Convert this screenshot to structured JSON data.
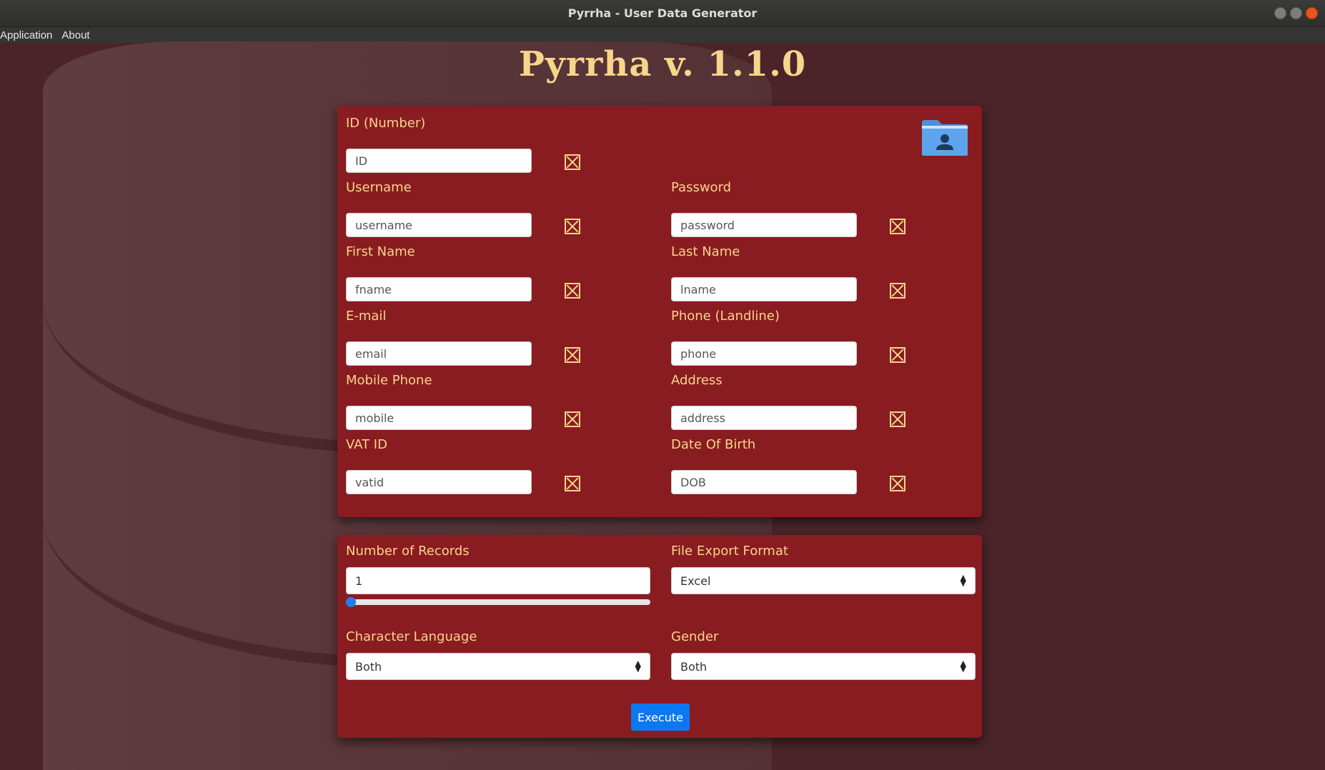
{
  "window": {
    "title": "Pyrrha - User Data Generator"
  },
  "menu": [
    "Application",
    "About"
  ],
  "app_title": "Pyrrha v. 1.1.0",
  "fields": [
    {
      "label": "ID (Number)",
      "placeholder": "ID"
    },
    {
      "label": "Username",
      "placeholder": "username"
    },
    {
      "label": "Password",
      "placeholder": "password"
    },
    {
      "label": "First Name",
      "placeholder": "fname"
    },
    {
      "label": "Last Name",
      "placeholder": "lname"
    },
    {
      "label": "E-mail",
      "placeholder": "email"
    },
    {
      "label": "Phone (Landline)",
      "placeholder": "phone"
    },
    {
      "label": "Mobile Phone",
      "placeholder": "mobile"
    },
    {
      "label": "Address",
      "placeholder": "address"
    },
    {
      "label": "VAT ID",
      "placeholder": "vatid"
    },
    {
      "label": "Date Of Birth",
      "placeholder": "DOB"
    }
  ],
  "settings": {
    "records_label": "Number of Records",
    "records_value": "1",
    "records_slider_fraction": 0.0,
    "export_label": "File Export Format",
    "export_value": "Excel",
    "language_label": "Character Language",
    "language_value": "Both",
    "gender_label": "Gender",
    "gender_value": "Both"
  },
  "execute_label": "Execute",
  "colors": {
    "panel": "#891c21",
    "label": "#f7d58a",
    "button": "#0b78f0",
    "background": "#4a2429"
  },
  "icons": [
    "folder-user-icon",
    "clear-field-icon",
    "select-arrow-icon"
  ]
}
